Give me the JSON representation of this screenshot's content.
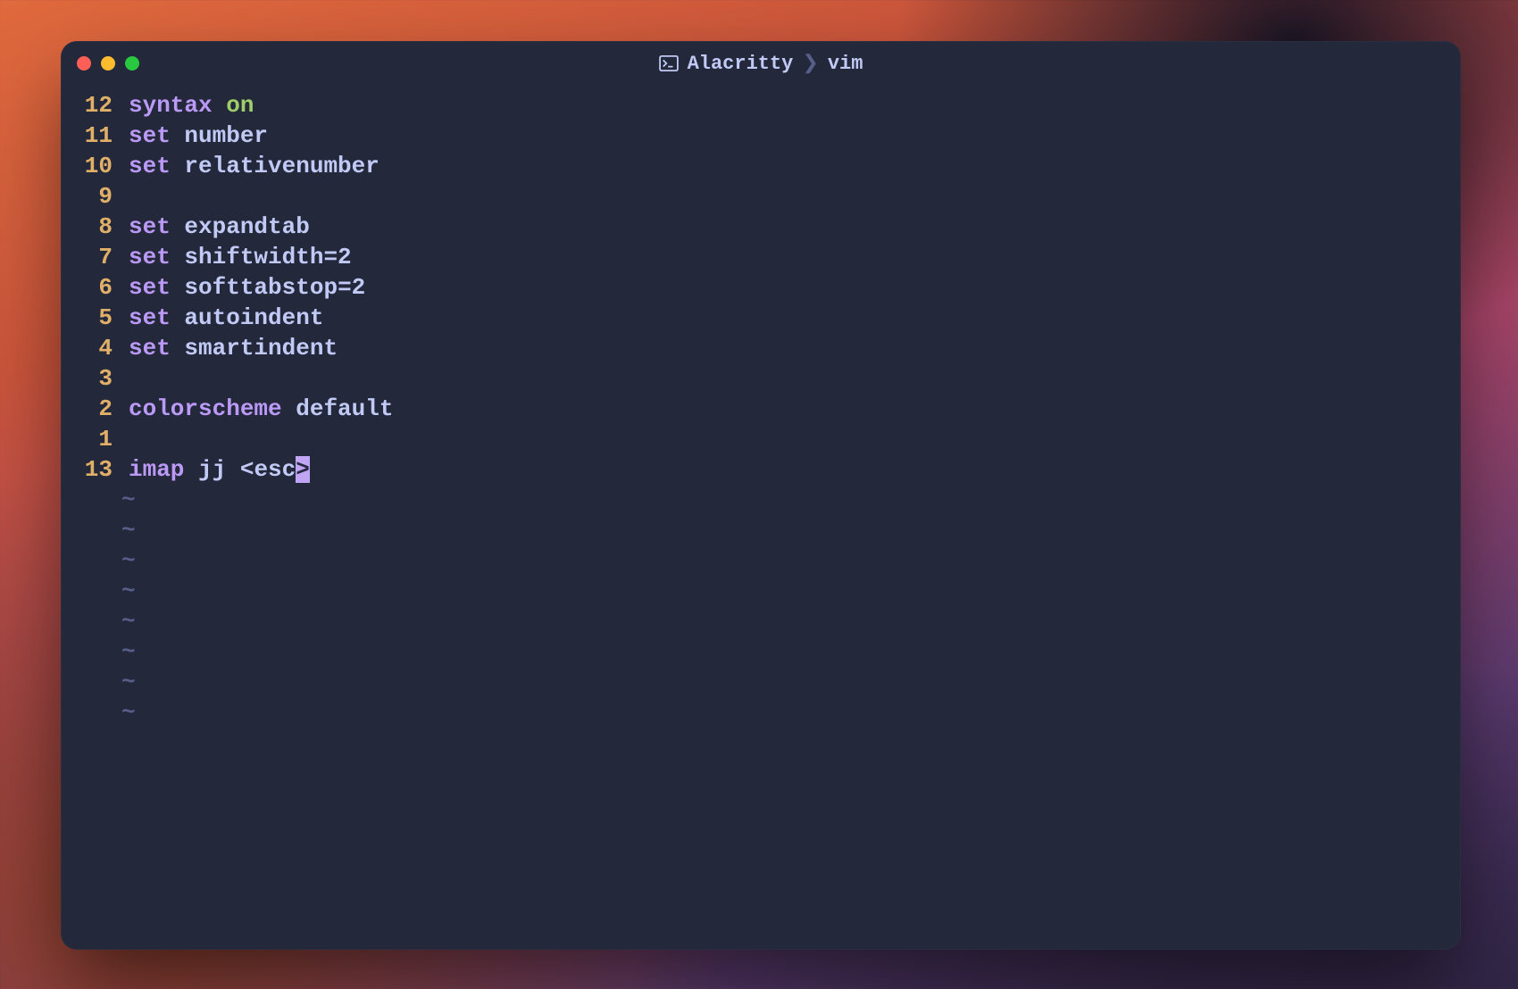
{
  "window": {
    "title_app": "Alacritty",
    "title_separator": "❯",
    "title_process": "vim"
  },
  "colors": {
    "traffic_red": "#ff5f57",
    "traffic_yellow": "#febc2e",
    "traffic_green": "#28c840"
  },
  "editor": {
    "cursor_line_absolute": 13,
    "lines": [
      {
        "num": "12",
        "tokens": [
          {
            "t": "syntax",
            "c": "kw"
          },
          {
            "t": " ",
            "c": "plain"
          },
          {
            "t": "on",
            "c": "on"
          }
        ]
      },
      {
        "num": "11",
        "tokens": [
          {
            "t": "set",
            "c": "kw"
          },
          {
            "t": " ",
            "c": "plain"
          },
          {
            "t": "number",
            "c": "id"
          }
        ]
      },
      {
        "num": "10",
        "tokens": [
          {
            "t": "set",
            "c": "kw"
          },
          {
            "t": " ",
            "c": "plain"
          },
          {
            "t": "relativenumber",
            "c": "id"
          }
        ]
      },
      {
        "num": "9",
        "tokens": []
      },
      {
        "num": "8",
        "tokens": [
          {
            "t": "set",
            "c": "kw"
          },
          {
            "t": " ",
            "c": "plain"
          },
          {
            "t": "expandtab",
            "c": "id"
          }
        ]
      },
      {
        "num": "7",
        "tokens": [
          {
            "t": "set",
            "c": "kw"
          },
          {
            "t": " ",
            "c": "plain"
          },
          {
            "t": "shiftwidth",
            "c": "id"
          },
          {
            "t": "=2",
            "c": "plain"
          }
        ]
      },
      {
        "num": "6",
        "tokens": [
          {
            "t": "set",
            "c": "kw"
          },
          {
            "t": " ",
            "c": "plain"
          },
          {
            "t": "softtabstop",
            "c": "id"
          },
          {
            "t": "=2",
            "c": "plain"
          }
        ]
      },
      {
        "num": "5",
        "tokens": [
          {
            "t": "set",
            "c": "kw"
          },
          {
            "t": " ",
            "c": "plain"
          },
          {
            "t": "autoindent",
            "c": "id"
          }
        ]
      },
      {
        "num": "4",
        "tokens": [
          {
            "t": "set",
            "c": "kw"
          },
          {
            "t": " ",
            "c": "plain"
          },
          {
            "t": "smartindent",
            "c": "id"
          }
        ]
      },
      {
        "num": "3",
        "tokens": []
      },
      {
        "num": "2",
        "tokens": [
          {
            "t": "colorscheme",
            "c": "kw"
          },
          {
            "t": " default",
            "c": "plain"
          }
        ]
      },
      {
        "num": "1",
        "tokens": []
      },
      {
        "num": "13",
        "current": true,
        "tokens": [
          {
            "t": "imap ",
            "c": "kw"
          },
          {
            "t": "jj ",
            "c": "plain"
          },
          {
            "t": "<",
            "c": "id"
          },
          {
            "t": "esc",
            "c": "id"
          },
          {
            "t": ">",
            "c": "cursor"
          }
        ]
      }
    ],
    "tilde_count": 8,
    "tilde_char": "~"
  }
}
